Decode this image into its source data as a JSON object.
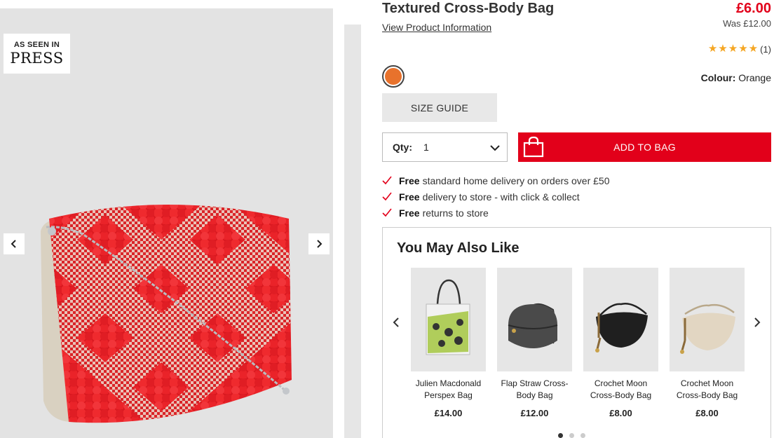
{
  "gallery": {
    "press_badge_small": "AS SEEN IN",
    "press_badge_big": "PRESS",
    "prev_icon": "chevron-left-icon",
    "next_icon": "chevron-right-icon",
    "image_background": "#e3e3e3",
    "bag_color": "#e8202a"
  },
  "product": {
    "title": "Textured Cross-Body Bag",
    "view_info_label": "View Product Information",
    "price": "£6.00",
    "was_price": "Was £12.00",
    "rating": {
      "stars": 5,
      "max": 5,
      "count_label": "(1)"
    },
    "colour_label": "Colour:",
    "colour_value": "Orange",
    "swatch_color": "#e8722c",
    "size_guide_label": "SIZE GUIDE",
    "qty_label": "Qty:",
    "qty_value": "1",
    "add_to_bag_label": "ADD TO BAG",
    "accent_color": "#e2001a"
  },
  "perks": [
    {
      "bold": "Free",
      "text": "standard home delivery on orders over £50"
    },
    {
      "bold": "Free",
      "text": "delivery to store - with click & collect"
    },
    {
      "bold": "Free",
      "text": "returns to store"
    }
  ],
  "recommendations": {
    "title": "You May Also Like",
    "items": [
      {
        "name": "Julien Macdonald Perspex Bag",
        "price": "£14.00"
      },
      {
        "name": "Flap Straw Cross-Body Bag",
        "price": "£12.00"
      },
      {
        "name": "Crochet Moon Cross-Body Bag",
        "price": "£8.00"
      },
      {
        "name": "Crochet Moon Cross-Body Bag",
        "price": "£8.00"
      }
    ],
    "pagination": {
      "pages": 3,
      "active": 1
    }
  }
}
